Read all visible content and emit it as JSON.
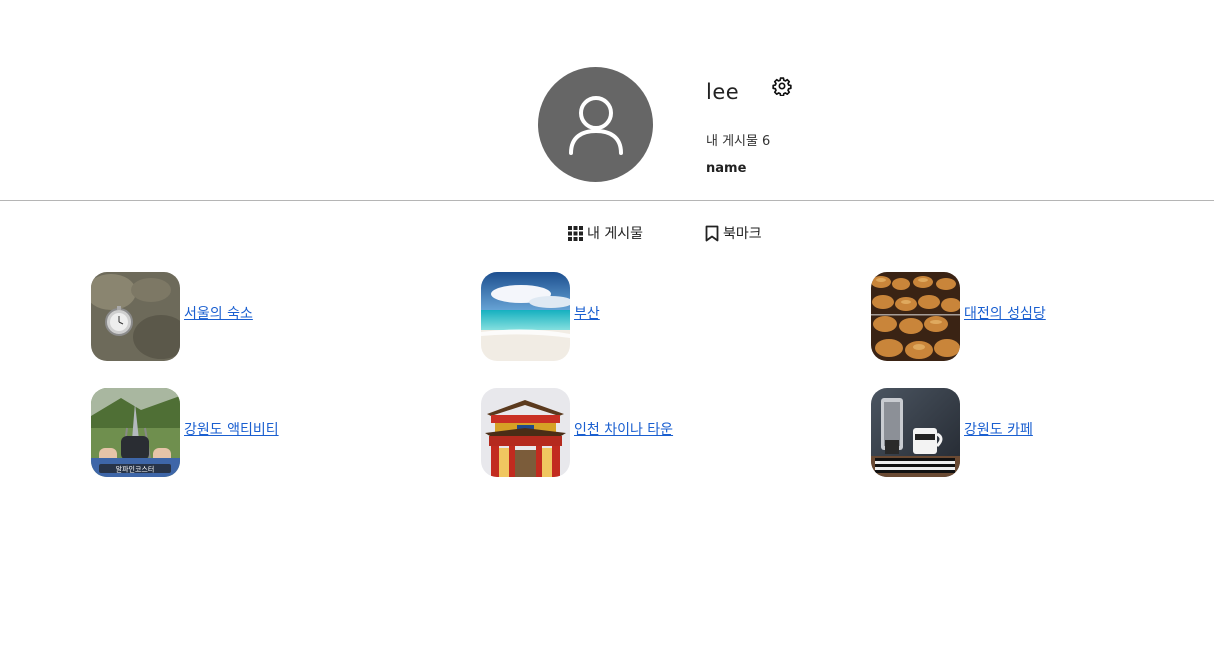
{
  "profile": {
    "username": "lee",
    "posts_label": "내 게시물",
    "posts_count": "6",
    "name_label": "name",
    "avatar_icon": "user-silhouette-icon",
    "settings_icon": "gear-icon"
  },
  "tabs": [
    {
      "label": "내 게시물",
      "icon": "grid-icon"
    },
    {
      "label": "북마크",
      "icon": "bookmark-icon"
    }
  ],
  "posts": [
    {
      "title": "서울의 숙소"
    },
    {
      "title": "부산"
    },
    {
      "title": "대전의 성심당"
    },
    {
      "title": "강원도 액티비티"
    },
    {
      "title": "인천 차이나 타운"
    },
    {
      "title": "강원도 카페"
    }
  ],
  "colors": {
    "avatar_bg": "#666666",
    "link": "#1a5fd0",
    "divider": "#b5b5b5"
  }
}
